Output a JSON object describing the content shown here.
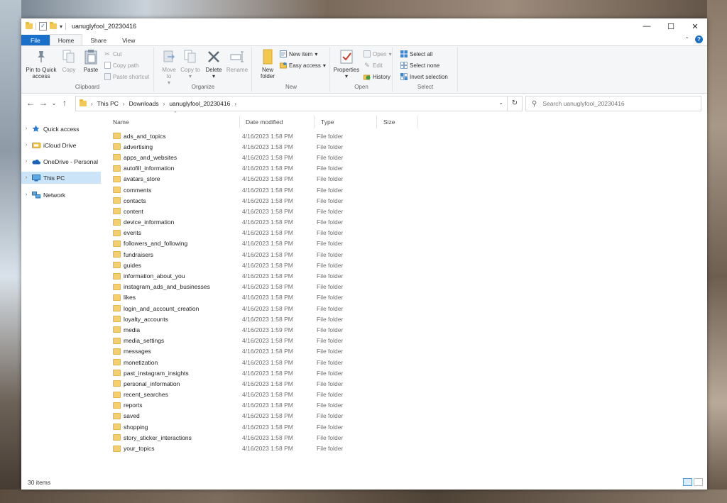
{
  "window": {
    "title": "uanuglyfool_20230416",
    "controls": [
      "—",
      "☐",
      "✕"
    ]
  },
  "ribbon_tabs": [
    "File",
    "Home",
    "Share",
    "View"
  ],
  "ribbon": {
    "clipboard": {
      "label": "Clipboard",
      "pin_to_quick_access": "Pin to Quick access",
      "copy": "Copy",
      "paste": "Paste",
      "cut": "Cut",
      "copy_path": "Copy path",
      "paste_shortcut": "Paste shortcut"
    },
    "organize": {
      "label": "Organize",
      "move_to": "Move to",
      "copy_to": "Copy to",
      "delete": "Delete",
      "rename": "Rename"
    },
    "new": {
      "label": "New",
      "new_folder": "New folder",
      "new_item": "New item",
      "easy_access": "Easy access"
    },
    "open": {
      "label": "Open",
      "properties": "Properties",
      "open": "Open",
      "edit": "Edit",
      "history": "History"
    },
    "select": {
      "label": "Select",
      "select_all": "Select all",
      "select_none": "Select none",
      "invert_selection": "Invert selection"
    }
  },
  "address": {
    "crumbs": [
      "This PC",
      "Downloads",
      "uanuglyfool_20230416"
    ],
    "search_placeholder": "Search uanuglyfool_20230416"
  },
  "nav_pane": [
    "Quick access",
    "iCloud Drive",
    "OneDrive - Personal",
    "This PC",
    "Network"
  ],
  "columns": {
    "name": "Name",
    "date_modified": "Date modified",
    "type": "Type",
    "size": "Size"
  },
  "files": [
    {
      "name": "ads_and_topics",
      "date": "4/16/2023 1:58 PM",
      "type": "File folder"
    },
    {
      "name": "advertising",
      "date": "4/16/2023 1:58 PM",
      "type": "File folder"
    },
    {
      "name": "apps_and_websites",
      "date": "4/16/2023 1:58 PM",
      "type": "File folder"
    },
    {
      "name": "autofill_information",
      "date": "4/16/2023 1:58 PM",
      "type": "File folder"
    },
    {
      "name": "avatars_store",
      "date": "4/16/2023 1:58 PM",
      "type": "File folder"
    },
    {
      "name": "comments",
      "date": "4/16/2023 1:58 PM",
      "type": "File folder"
    },
    {
      "name": "contacts",
      "date": "4/16/2023 1:58 PM",
      "type": "File folder"
    },
    {
      "name": "content",
      "date": "4/16/2023 1:58 PM",
      "type": "File folder"
    },
    {
      "name": "device_information",
      "date": "4/16/2023 1:58 PM",
      "type": "File folder"
    },
    {
      "name": "events",
      "date": "4/16/2023 1:58 PM",
      "type": "File folder"
    },
    {
      "name": "followers_and_following",
      "date": "4/16/2023 1:58 PM",
      "type": "File folder"
    },
    {
      "name": "fundraisers",
      "date": "4/16/2023 1:58 PM",
      "type": "File folder"
    },
    {
      "name": "guides",
      "date": "4/16/2023 1:58 PM",
      "type": "File folder"
    },
    {
      "name": "information_about_you",
      "date": "4/16/2023 1:58 PM",
      "type": "File folder"
    },
    {
      "name": "instagram_ads_and_businesses",
      "date": "4/16/2023 1:58 PM",
      "type": "File folder"
    },
    {
      "name": "likes",
      "date": "4/16/2023 1:58 PM",
      "type": "File folder"
    },
    {
      "name": "login_and_account_creation",
      "date": "4/16/2023 1:58 PM",
      "type": "File folder"
    },
    {
      "name": "loyalty_accounts",
      "date": "4/16/2023 1:58 PM",
      "type": "File folder"
    },
    {
      "name": "media",
      "date": "4/16/2023 1:59 PM",
      "type": "File folder"
    },
    {
      "name": "media_settings",
      "date": "4/16/2023 1:58 PM",
      "type": "File folder"
    },
    {
      "name": "messages",
      "date": "4/16/2023 1:58 PM",
      "type": "File folder"
    },
    {
      "name": "monetization",
      "date": "4/16/2023 1:58 PM",
      "type": "File folder"
    },
    {
      "name": "past_instagram_insights",
      "date": "4/16/2023 1:58 PM",
      "type": "File folder"
    },
    {
      "name": "personal_information",
      "date": "4/16/2023 1:58 PM",
      "type": "File folder"
    },
    {
      "name": "recent_searches",
      "date": "4/16/2023 1:58 PM",
      "type": "File folder"
    },
    {
      "name": "reports",
      "date": "4/16/2023 1:58 PM",
      "type": "File folder"
    },
    {
      "name": "saved",
      "date": "4/16/2023 1:58 PM",
      "type": "File folder"
    },
    {
      "name": "shopping",
      "date": "4/16/2023 1:58 PM",
      "type": "File folder"
    },
    {
      "name": "story_sticker_interactions",
      "date": "4/16/2023 1:58 PM",
      "type": "File folder"
    },
    {
      "name": "your_topics",
      "date": "4/16/2023 1:58 PM",
      "type": "File folder"
    }
  ],
  "status": {
    "item_count": "30 items"
  },
  "colors": {
    "accent": "#1a6fc8",
    "selection": "#cce4f7",
    "folder": "#f5cf6a"
  }
}
